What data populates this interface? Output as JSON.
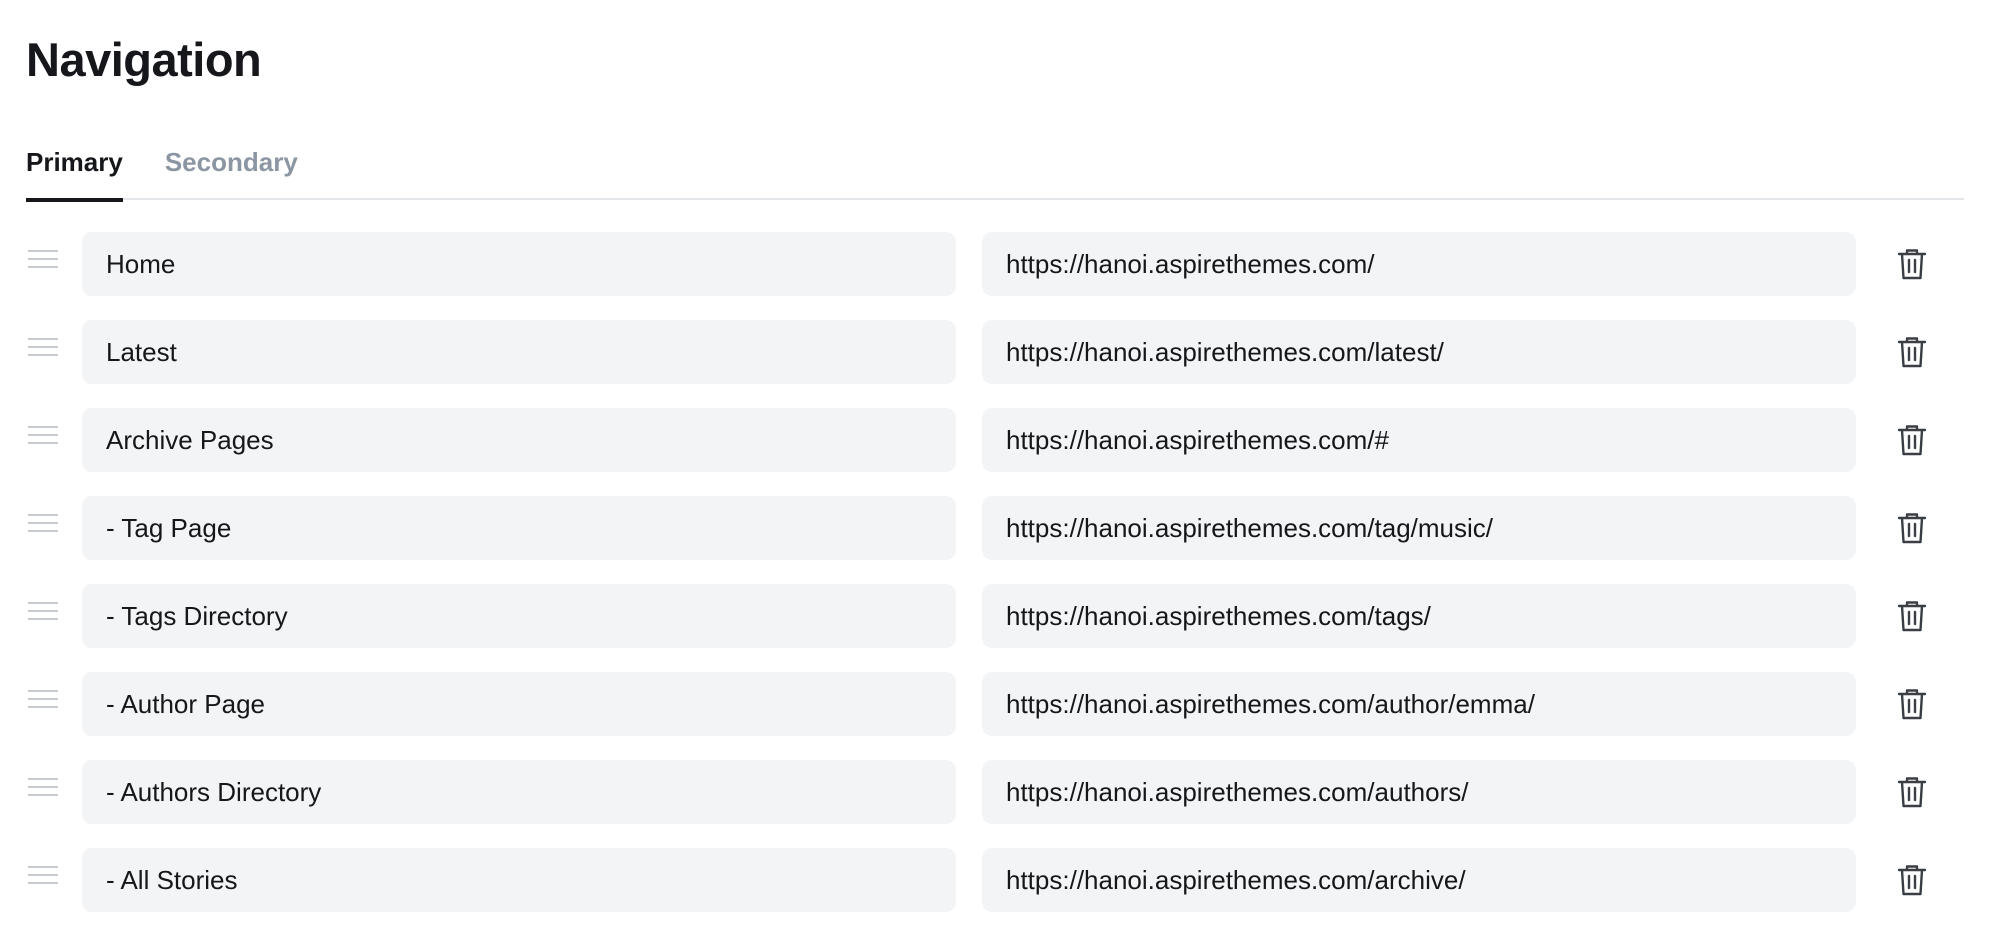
{
  "header": {
    "title": "Navigation"
  },
  "tabs": [
    {
      "label": "Primary",
      "active": true
    },
    {
      "label": "Secondary",
      "active": false
    }
  ],
  "icons": {
    "drag": "drag-handle-icon",
    "delete": "trash-icon"
  },
  "colors": {
    "text": "#15171a",
    "muted_tab": "#8c96a3",
    "field_bg": "#f3f4f6",
    "divider": "#e3e6e9",
    "handle": "#c6cbd1"
  },
  "items": [
    {
      "label": "Home",
      "url": "https://hanoi.aspirethemes.com/"
    },
    {
      "label": "Latest",
      "url": "https://hanoi.aspirethemes.com/latest/"
    },
    {
      "label": "Archive Pages",
      "url": "https://hanoi.aspirethemes.com/#"
    },
    {
      "label": "- Tag Page",
      "url": "https://hanoi.aspirethemes.com/tag/music/"
    },
    {
      "label": "- Tags Directory",
      "url": "https://hanoi.aspirethemes.com/tags/"
    },
    {
      "label": "- Author Page",
      "url": "https://hanoi.aspirethemes.com/author/emma/"
    },
    {
      "label": "- Authors Directory",
      "url": "https://hanoi.aspirethemes.com/authors/"
    },
    {
      "label": "- All Stories",
      "url": "https://hanoi.aspirethemes.com/archive/"
    }
  ]
}
